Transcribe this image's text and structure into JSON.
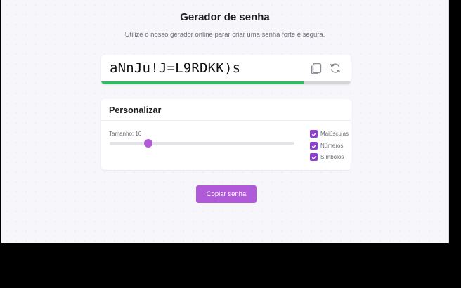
{
  "header": {
    "title": "Gerador de senha",
    "subtitle": "Utilize o nosso gerador online parar criar uma senha forte e segura."
  },
  "password": {
    "value": "aNnJu!J=L9RDKK)s",
    "strength_fraction": 0.81,
    "strength_color": "#35b863",
    "copy_icon": "copy-icon",
    "refresh_icon": "refresh-icon"
  },
  "settings": {
    "title": "Personalizar",
    "length_label": "Tamanho: 16",
    "slider_fraction": 0.21,
    "options": [
      {
        "label": "Maiúsculas",
        "checked": true
      },
      {
        "label": "Números",
        "checked": true
      },
      {
        "label": "Símbolos",
        "checked": true
      }
    ]
  },
  "actions": {
    "copy_label": "Copiar senha"
  },
  "colors": {
    "accent": "#b05ad9",
    "checkbox": "#8d3fcf"
  }
}
